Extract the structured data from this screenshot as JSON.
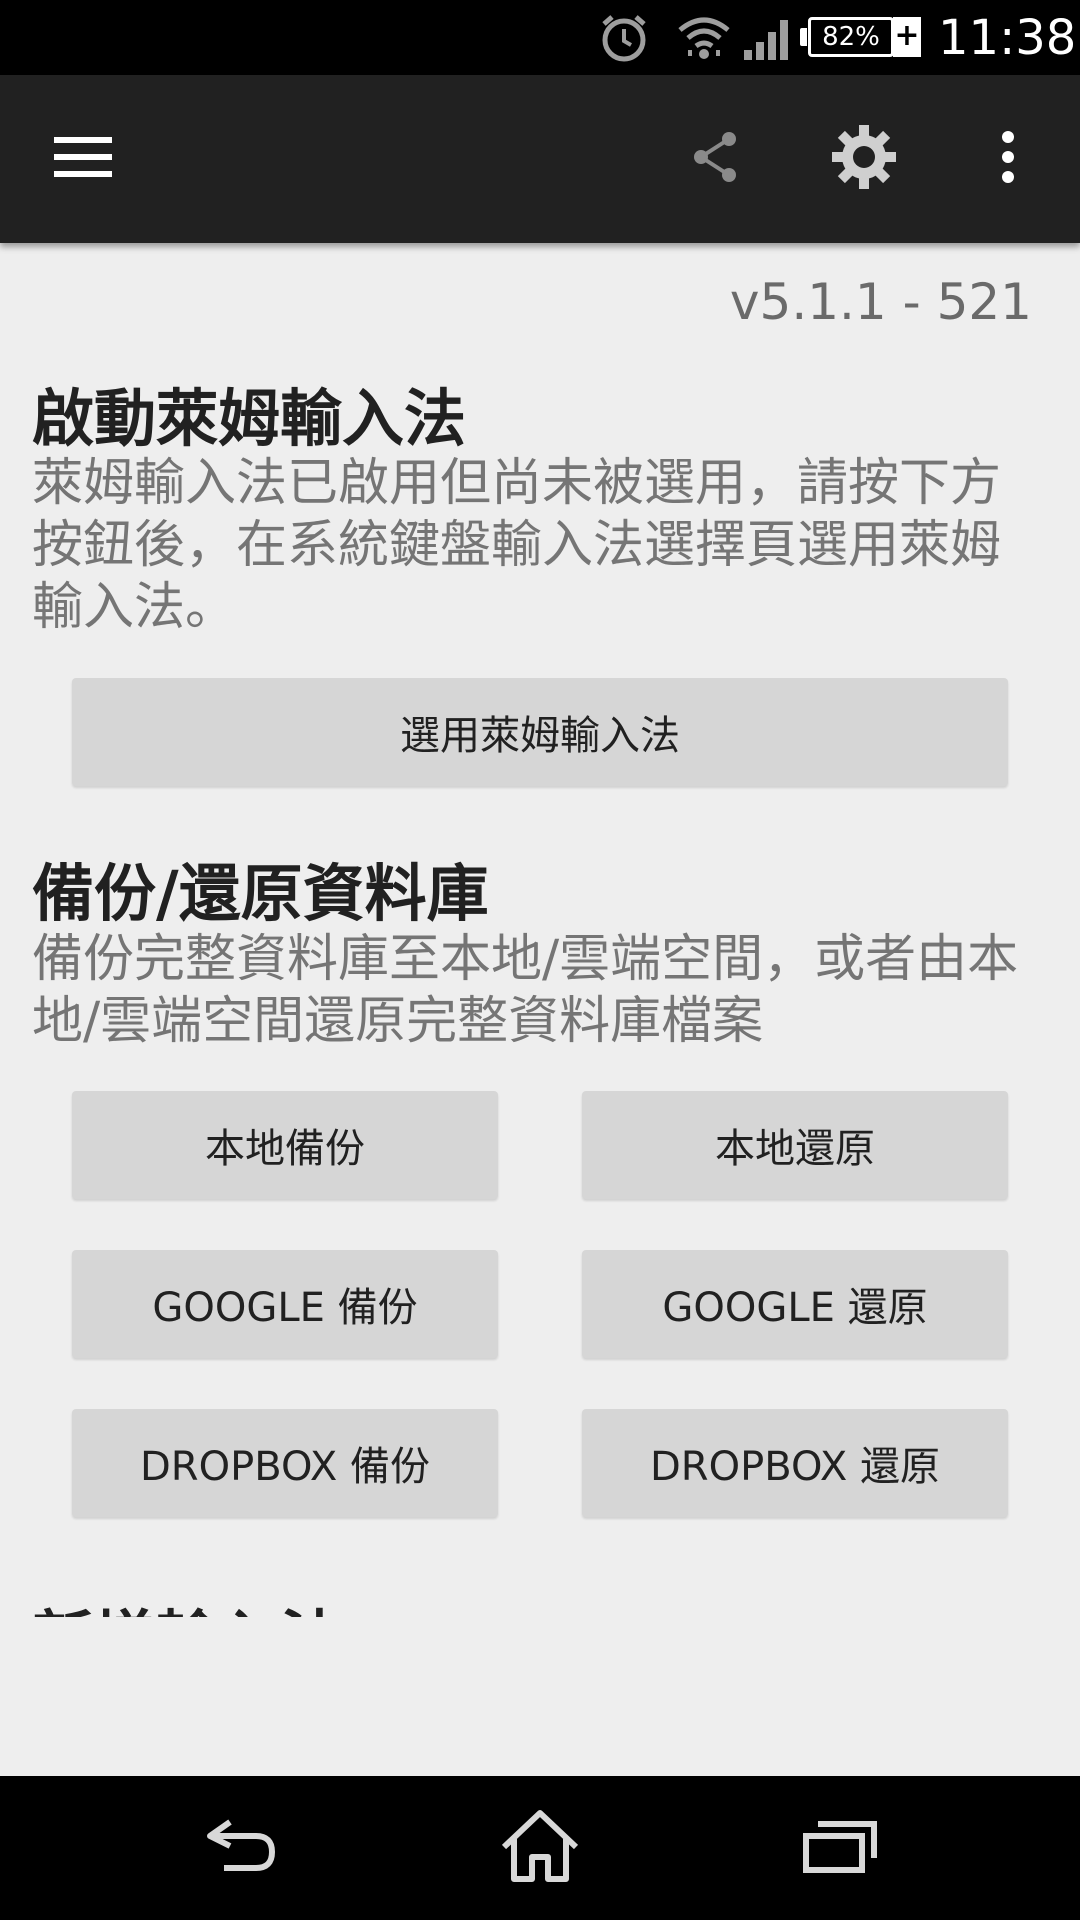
{
  "status_bar": {
    "icons": [
      "alarm-icon",
      "wifi-icon",
      "signal-icon",
      "battery-icon"
    ],
    "battery_level": "82%",
    "charging_symbol": "+",
    "time": "11:38"
  },
  "toolbar": {
    "icons": [
      "menu-icon",
      "share-icon",
      "settings-icon",
      "more-vert-icon"
    ]
  },
  "content": {
    "version": "v5.1.1 - 521",
    "activate_section": {
      "title": "啟動萊姆輸入法",
      "description": "萊姆輸入法已啟用但尚未被選用，請按下方按鈕後，在系統鍵盤輸入法選擇頁選用萊姆輸入法。",
      "button_label": "選用萊姆輸入法"
    },
    "backup_section": {
      "title": "備份/還原資料庫",
      "description": "備份完整資料庫至本地/雲端空間，或者由本地/雲端空間還原完整資料庫檔案",
      "buttons": {
        "local_backup": "本地備份",
        "local_restore": "本地還原",
        "google_backup": "GOOGLE 備份",
        "google_restore": "GOOGLE 還原",
        "dropbox_backup": "DROPBOX 備份",
        "dropbox_restore": "DROPBOX 還原"
      }
    },
    "next_section": {
      "title": "新增輸入法"
    }
  },
  "nav_bar": {
    "icons": [
      "back-icon",
      "home-icon",
      "recents-icon"
    ]
  }
}
